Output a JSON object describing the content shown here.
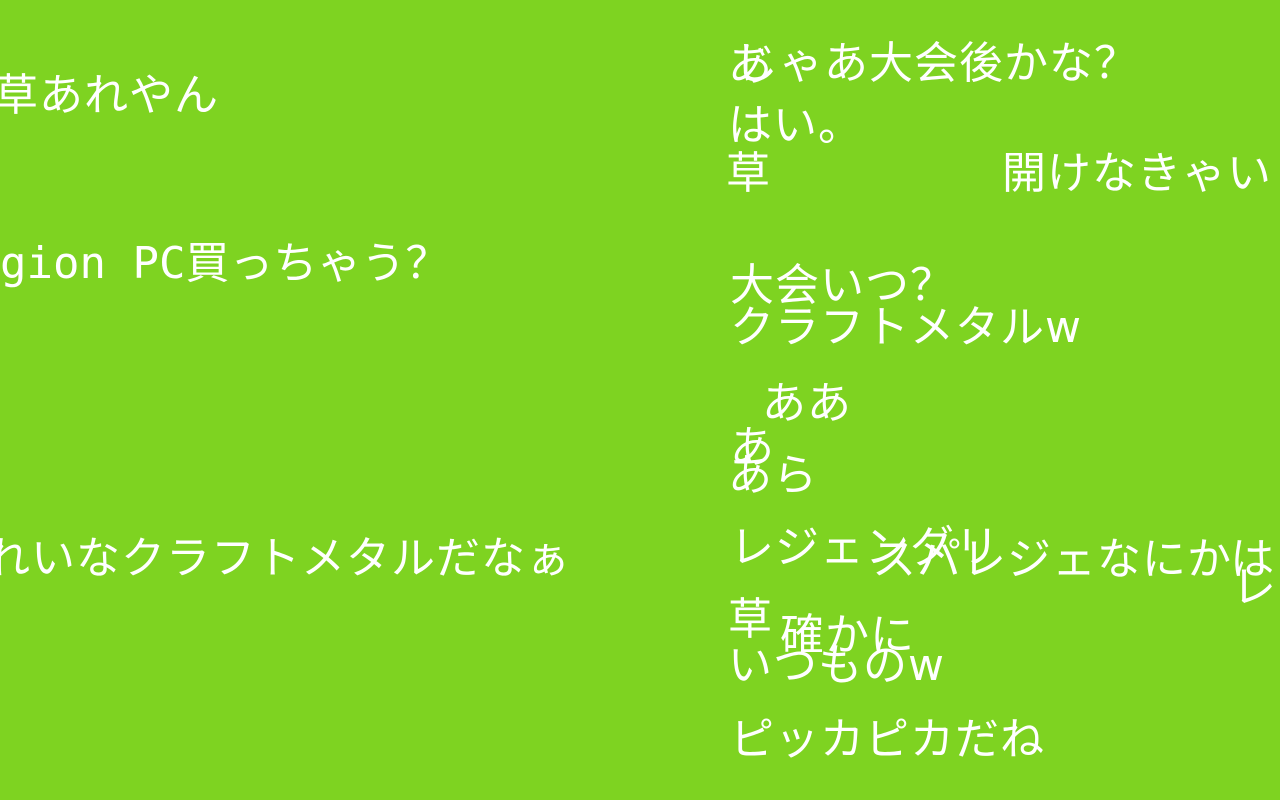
{
  "theme": {
    "background": "#7ed321",
    "text_color": "#ffffff"
  },
  "comments": {
    "c01": "草あれやん",
    "c02": "gion PC買っちゃう？",
    "c03": "れいなクラフトメタルだなぁ",
    "c04": "じゃあ大会後かな？",
    "c05": "あ",
    "c06": "はい。",
    "c07": "草",
    "c08": "開けなきゃい",
    "c09": "大会いつ？",
    "c10": "クラフトメタルw",
    "c11": "ああ",
    "c12": "あ",
    "c13": "あら",
    "c14": "レジェンダリ",
    "c15": "スパレジェなにかは",
    "c16": "レ",
    "c17": "草",
    "c18": "確かに",
    "c19": "いつものw",
    "c20": "ピッカピカだね"
  }
}
